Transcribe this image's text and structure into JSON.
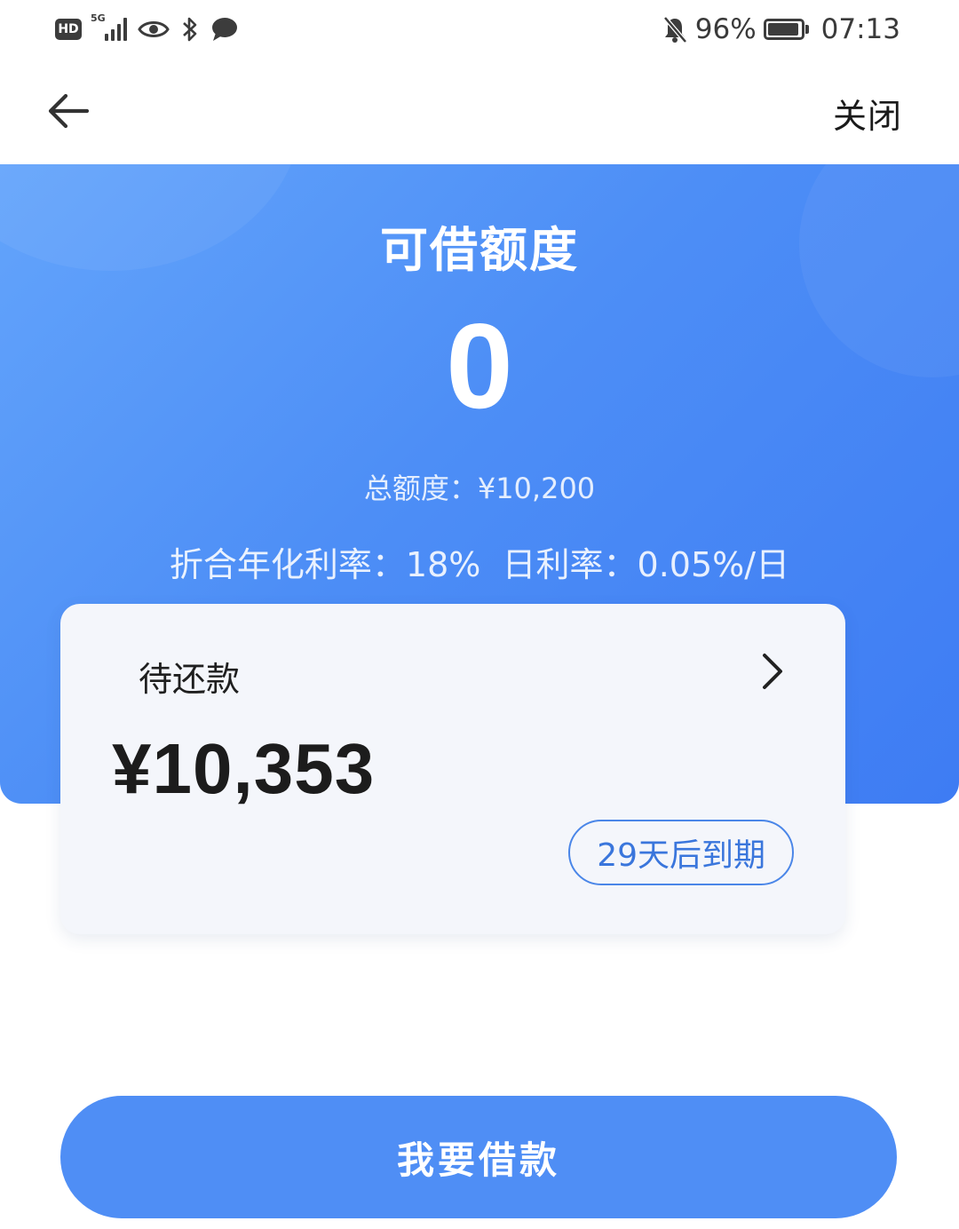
{
  "status_bar": {
    "hd_label": "HD",
    "network_label": "5G",
    "battery_percent_text": "96%",
    "battery_level": 0.96,
    "time": "07:13",
    "icons": [
      "hd-icon",
      "signal-icon",
      "eye-icon",
      "bluetooth-icon",
      "message-icon",
      "bell-muted-icon",
      "battery-icon"
    ]
  },
  "nav": {
    "back_icon": "arrow-left-icon",
    "close_label": "关闭"
  },
  "hero": {
    "title": "可借额度",
    "available_amount": "0",
    "total_limit_text": "总额度：¥10,200",
    "annual_rate_text": "折合年化利率：18%",
    "daily_rate_text": "日利率：0.05%/日"
  },
  "repayment_card": {
    "label": "待还款",
    "amount": "¥10,353",
    "due_badge": "29天后到期",
    "chevron_icon": "chevron-right-icon"
  },
  "primary_button": {
    "label": "我要借款"
  },
  "colors": {
    "hero_start": "#63a4fb",
    "hero_end": "#3e7cf3",
    "button": "#4f8ef5",
    "badge_border": "#4a86e8",
    "card_bg": "#f4f6fb"
  }
}
